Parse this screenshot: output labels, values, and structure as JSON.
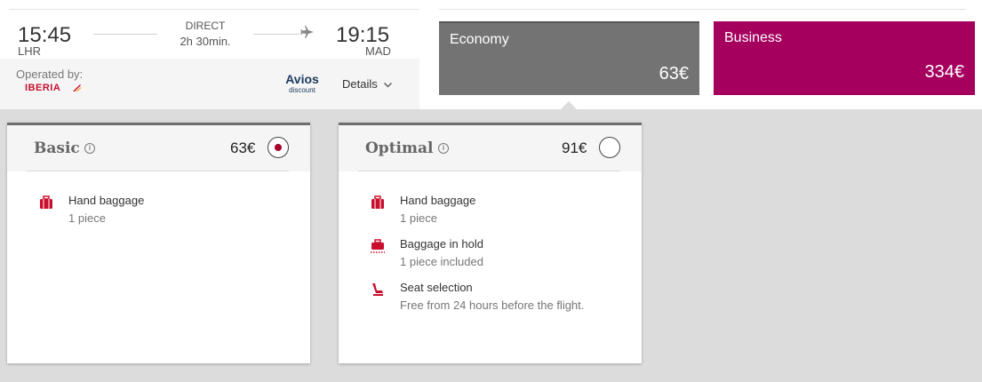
{
  "flight": {
    "departure_time": "15:45",
    "departure_code": "LHR",
    "route_type": "DIRECT",
    "duration": "2h 30min.",
    "arrival_time": "19:15",
    "arrival_code": "MAD",
    "plane_icon": "plane-icon",
    "operated_by_label": "Operated by:",
    "airline_name": "IBERIA",
    "avios_label": "Avios",
    "avios_sub": "discount",
    "details_label": "Details",
    "details_icon": "chevron-down-icon"
  },
  "cabins": {
    "economy": {
      "name": "Economy",
      "price": "63€",
      "color": "#737373"
    },
    "business": {
      "name": "Business",
      "price": "334€",
      "color": "#a6005e"
    }
  },
  "fares": {
    "basic": {
      "title": "Basic",
      "price": "63€",
      "selected": true,
      "features": [
        {
          "icon": "hand-baggage-icon",
          "title": "Hand baggage",
          "desc": "1 piece"
        }
      ]
    },
    "optimal": {
      "title": "Optimal",
      "price": "91€",
      "selected": false,
      "features": [
        {
          "icon": "hand-baggage-icon",
          "title": "Hand baggage",
          "desc": "1 piece"
        },
        {
          "icon": "hold-baggage-icon",
          "title": "Baggage in hold",
          "desc": "1 piece included"
        },
        {
          "icon": "seat-icon",
          "title": "Seat selection",
          "desc": "Free from 24 hours before the flight."
        }
      ]
    }
  },
  "colors": {
    "accent_red": "#c8102e",
    "radio_dot": "#a6002b"
  }
}
